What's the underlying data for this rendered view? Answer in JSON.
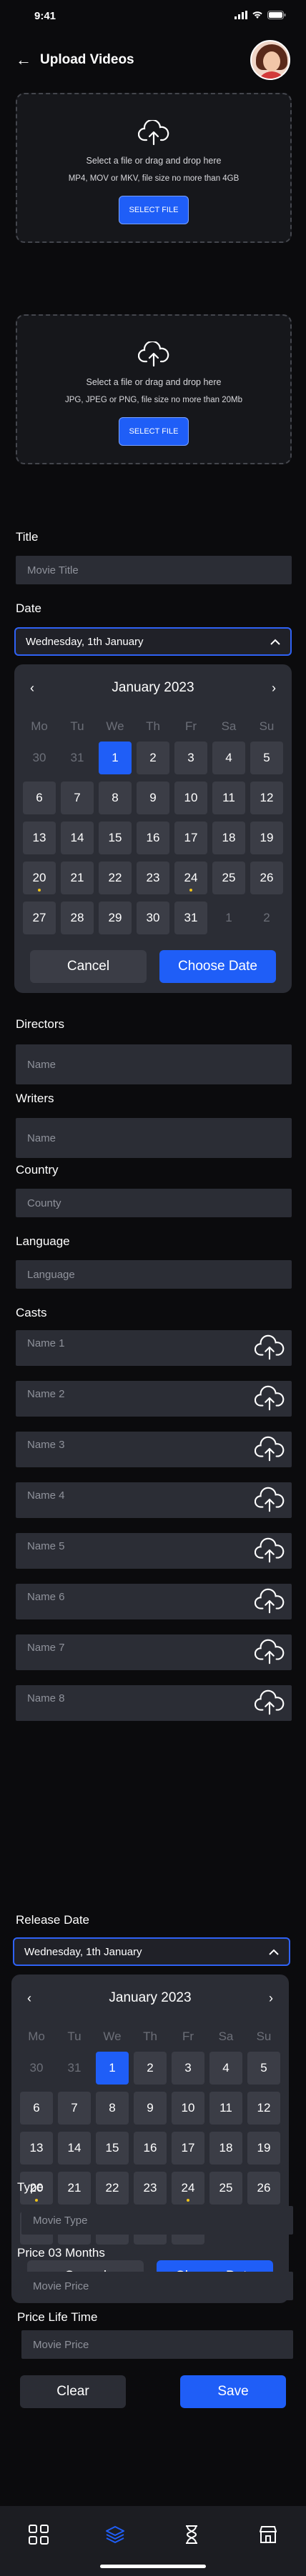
{
  "status_bar": {
    "time": "9:41"
  },
  "header": {
    "title": "Upload Videos"
  },
  "video_upload": {
    "text": "Select a file or drag and drop here",
    "sub": "MP4, MOV or MKV, file size no more than 4GB",
    "button": "SELECT FILE"
  },
  "image_upload": {
    "text": "Select a file or drag and drop here",
    "sub": "JPG, JPEG or PNG, file size no more than 20Mb",
    "button": "SELECT FILE"
  },
  "title_field": {
    "label": "Title",
    "placeholder": "Movie Title"
  },
  "date_field": {
    "label": "Date",
    "value": "Wednesday, 1th January"
  },
  "calendar": {
    "month": "January 2023",
    "weekdays": [
      "Mo",
      "Tu",
      "We",
      "Th",
      "Fr",
      "Sa",
      "Su"
    ],
    "weeks": [
      [
        "30",
        "31",
        "1",
        "2",
        "3",
        "4",
        "5"
      ],
      [
        "6",
        "7",
        "8",
        "9",
        "10",
        "11",
        "12"
      ],
      [
        "13",
        "14",
        "15",
        "16",
        "17",
        "18",
        "19"
      ],
      [
        "20",
        "21",
        "22",
        "23",
        "24",
        "25",
        "26"
      ],
      [
        "27",
        "28",
        "29",
        "30",
        "31",
        "1",
        "2"
      ]
    ],
    "muted": [
      [
        0,
        0
      ],
      [
        0,
        1
      ],
      [
        4,
        5
      ],
      [
        4,
        6
      ]
    ],
    "selected": [
      0,
      2
    ],
    "dots": [
      [
        3,
        0
      ],
      [
        3,
        4
      ]
    ],
    "cancel": "Cancel",
    "choose": "Choose Date"
  },
  "directors_field": {
    "label": "Directors",
    "placeholder": "Name"
  },
  "writers_field": {
    "label": "Writers",
    "placeholder": "Name"
  },
  "country_field": {
    "label": "Country",
    "placeholder": "County"
  },
  "language_field": {
    "label": "Language",
    "placeholder": "Language"
  },
  "casts": {
    "label": "Casts",
    "names": [
      "Name 1",
      "Name 2",
      "Name 3",
      "Name 4",
      "Name 5",
      "Name 6",
      "Name 7",
      "Name 8"
    ]
  },
  "release_date": {
    "label": "Release Date",
    "value": "Wednesday, 1th January"
  },
  "calendar2": {
    "month": "January 2023",
    "cancel": "Cancel",
    "choose": "Choose Date"
  },
  "type_field": {
    "label": "Type",
    "placeholder": "Movie Type"
  },
  "price3_field": {
    "label": "Price 03 Months",
    "placeholder": "Movie Price"
  },
  "pricelife_field": {
    "label": "Price Life Time",
    "placeholder": "Movie Price"
  },
  "actions": {
    "clear": "Clear",
    "save": "Save"
  },
  "tabs": [
    {
      "icon": "grid-icon",
      "active": false
    },
    {
      "icon": "layers-icon",
      "active": true
    },
    {
      "icon": "hourglass-icon",
      "active": false
    },
    {
      "icon": "shop-icon",
      "active": false
    }
  ],
  "colors": {
    "accent": "#1f5ef7",
    "bg": "#0b0b0d",
    "field": "#2b2d35",
    "dot": "#f0c419"
  }
}
